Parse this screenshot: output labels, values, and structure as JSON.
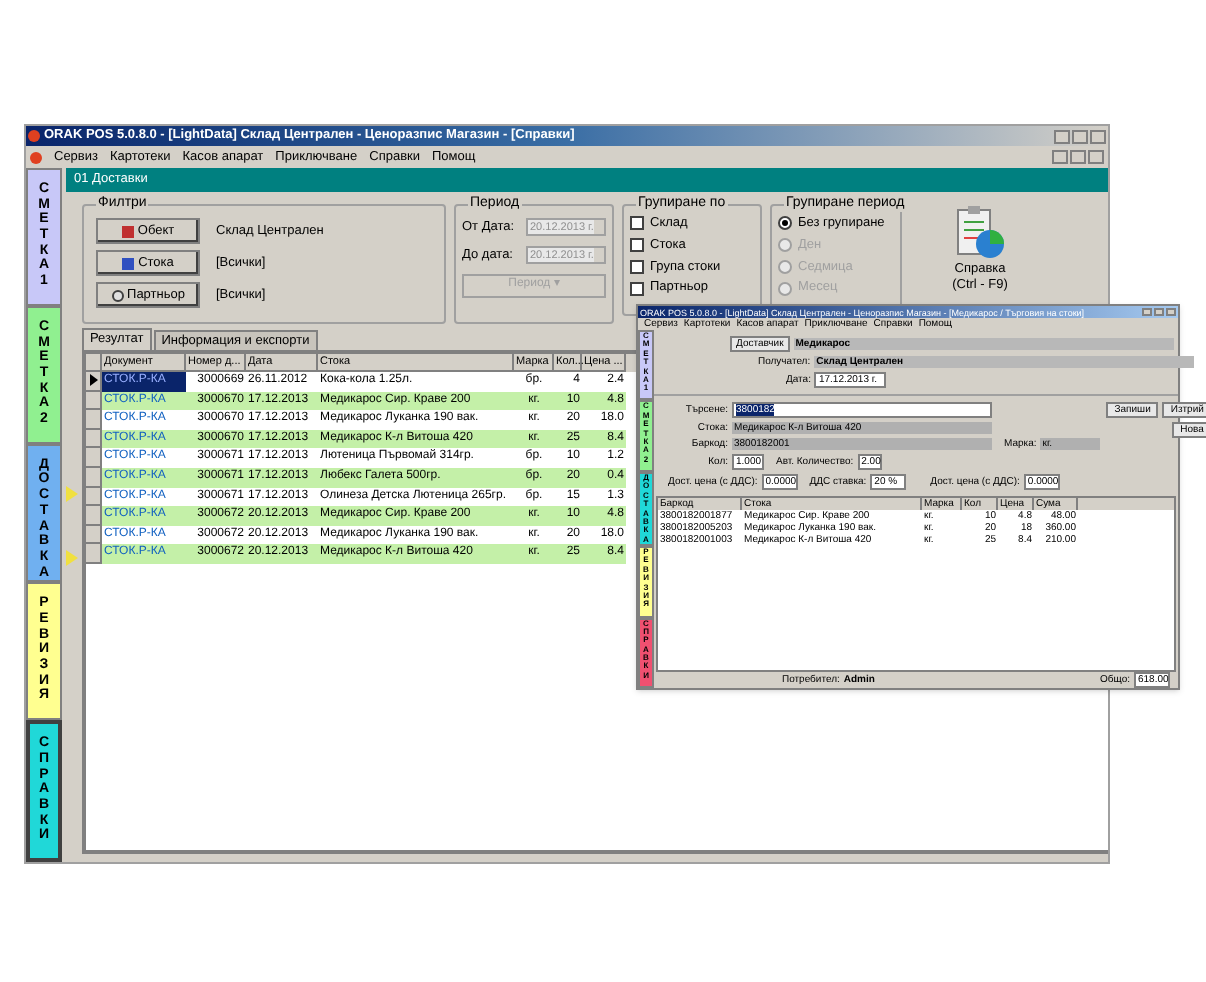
{
  "window": {
    "title": "ORAK POS 5.0.8.0 - [LightData] Склад Централен - Ценоразпис Магазин - [Справки]"
  },
  "menu": [
    "Сервиз",
    "Картотеки",
    "Касов апарат",
    "Приключване",
    "Справки",
    "Помощ"
  ],
  "sidebar": {
    "items": [
      {
        "label": "СМЕТКА 1",
        "color": "#c8c8f8",
        "selected": false
      },
      {
        "label": "СМЕТКА 2",
        "color": "#90f090",
        "selected": false
      },
      {
        "label": "ДОСТАВКА",
        "color": "#70b0f0",
        "selected": false
      },
      {
        "label": "РЕВИЗИЯ",
        "color": "#ffff90",
        "selected": false
      },
      {
        "label": "СПРАВКИ",
        "color": "#20d8d8",
        "selected": true
      }
    ]
  },
  "header": "01 Доставки",
  "filters": {
    "title": "Филтри",
    "rows": [
      {
        "button": "Обект",
        "value": "Склад Централен"
      },
      {
        "button": "Стока",
        "value": "[Всички]"
      },
      {
        "button": "Партньор",
        "value": "[Всички]"
      }
    ]
  },
  "period": {
    "title": "Период",
    "from_label": "От Дата:",
    "from_value": "20.12.2013 г.",
    "to_label": "До дата:",
    "to_value": "20.12.2013 г.",
    "button": "Период ▾",
    "button_disabled": true
  },
  "group_by": {
    "title": "Групиране по",
    "options": [
      {
        "label": "Склад",
        "checked": false
      },
      {
        "label": "Стока",
        "checked": false
      },
      {
        "label": "Група стоки",
        "checked": false
      },
      {
        "label": "Партньор",
        "checked": false
      }
    ]
  },
  "group_period": {
    "title": "Групиране период",
    "options": [
      {
        "label": "Без групиране",
        "selected": true,
        "disabled": false
      },
      {
        "label": "Ден",
        "selected": false,
        "disabled": true
      },
      {
        "label": "Седмица",
        "selected": false,
        "disabled": true
      },
      {
        "label": "Месец",
        "selected": false,
        "disabled": true
      }
    ]
  },
  "report_button": {
    "label": "Справка",
    "shortcut": "(Ctrl - F9)"
  },
  "tabs": [
    {
      "label": "Резултат",
      "selected": true
    },
    {
      "label": "Информация и експорти",
      "selected": false
    }
  ],
  "table": {
    "columns": [
      "Документ",
      "Номер д...",
      "Дата",
      "Стока",
      "Марка",
      "Кол...",
      "Цена ..."
    ],
    "rows": [
      {
        "cells": [
          "СТОК.Р-КА",
          "3000669",
          "26.11.2012",
          "Кока-кола 1.25л.",
          "бр.",
          "4",
          "2.4"
        ],
        "selected": true
      },
      {
        "cells": [
          "СТОК.Р-КА",
          "3000670",
          "17.12.2013",
          "Медикарос Сир. Краве 200",
          "кг.",
          "10",
          "4.8"
        ],
        "selected": false
      },
      {
        "cells": [
          "СТОК.Р-КА",
          "3000670",
          "17.12.2013",
          "Медикарос Луканка 190 вак.",
          "кг.",
          "20",
          "18.0"
        ],
        "selected": false
      },
      {
        "cells": [
          "СТОК.Р-КА",
          "3000670",
          "17.12.2013",
          "Медикарос К-л Витоша 420",
          "кг.",
          "25",
          "8.4"
        ],
        "selected": false
      },
      {
        "cells": [
          "СТОК.Р-КА",
          "3000671",
          "17.12.2013",
          "Лютеница Първомай 314гр.",
          "бр.",
          "10",
          "1.2"
        ],
        "selected": false
      },
      {
        "cells": [
          "СТОК.Р-КА",
          "3000671",
          "17.12.2013",
          "Любекс Галета 500гр.",
          "бр.",
          "20",
          "0.4"
        ],
        "selected": false
      },
      {
        "cells": [
          "СТОК.Р-КА",
          "3000671",
          "17.12.2013",
          "Олинеза Детска Лютеница 265гр.",
          "бр.",
          "15",
          "1.3"
        ],
        "selected": false
      },
      {
        "cells": [
          "СТОК.Р-КА",
          "3000672",
          "20.12.2013",
          "Медикарос Сир. Краве 200",
          "кг.",
          "10",
          "4.8"
        ],
        "selected": false
      },
      {
        "cells": [
          "СТОК.Р-КА",
          "3000672",
          "20.12.2013",
          "Медикарос Луканка 190 вак.",
          "кг.",
          "20",
          "18.0"
        ],
        "selected": false
      },
      {
        "cells": [
          "СТОК.Р-КА",
          "3000672",
          "20.12.2013",
          "Медикарос К-л Витоша 420",
          "кг.",
          "25",
          "8.4"
        ],
        "selected": false
      }
    ]
  },
  "inset_window": {
    "title": "ORAK POS 5.0.8.0 - [LightData] Склад Централен - Ценоразпис Магазин - [Медикарос / Търговия на стоки]",
    "menu": [
      "Сервиз",
      "Картотеки",
      "Касов апарат",
      "Приключване",
      "Справки",
      "Помощ"
    ],
    "sidebar": [
      {
        "label": "СМЕТКА 1",
        "color": "#c8c8f8"
      },
      {
        "label": "СМЕТКА 2",
        "color": "#90f090"
      },
      {
        "label": "ДОСТАВКА",
        "color": "#20d8d8"
      },
      {
        "label": "РЕВИЗИЯ",
        "color": "#ffff90"
      },
      {
        "label": "СПРАВКИ",
        "color": "#f05070"
      }
    ],
    "supplier_button": "Доставчик",
    "supplier": "Медикарос",
    "receiver_label": "Получател:",
    "receiver": "Склад Централен",
    "date_label": "Дата:",
    "date": "17.12.2013 г.",
    "fields": [
      {
        "label": "Търсене:",
        "value": "3800182"
      },
      {
        "label": "Стока:",
        "value": "Медикарос К-л Витоша 420"
      },
      {
        "label": "Баркод:",
        "value": "3800182001"
      }
    ],
    "unit_label": "Марка:",
    "unit": "кг.",
    "qty_label": "Кол:",
    "qty": "1.000",
    "auto_label": "Авт. Количество:",
    "auto": "2.00",
    "price_label": "Дост. цена (с ДДС):",
    "price": "0.0000",
    "vat_label": "ДДС ставка:",
    "vat": "20 %",
    "price2_label": "Дост. цена (с ДДС):",
    "price2": "0.0000",
    "buttons": [
      "Запиши",
      "Изтрий",
      "Нова"
    ],
    "columns": [
      "Баркод",
      "Стока",
      "Марка",
      "Кол",
      "Цена",
      "Сума"
    ],
    "rows": [
      [
        "3800182001877",
        "Медикарос Сир. Краве 200",
        "кг.",
        "10",
        "4.8",
        "48.00"
      ],
      [
        "3800182005203",
        "Медикарос Луканка 190 вак.",
        "кг.",
        "20",
        "18",
        "360.00"
      ],
      [
        "3800182001003",
        "Медикарос К-л Витоша 420",
        "кг.",
        "25",
        "8.4",
        "210.00"
      ]
    ],
    "user_label": "Потребител:",
    "user": "Admin",
    "total_label": "Общо:",
    "total": "618.00"
  }
}
